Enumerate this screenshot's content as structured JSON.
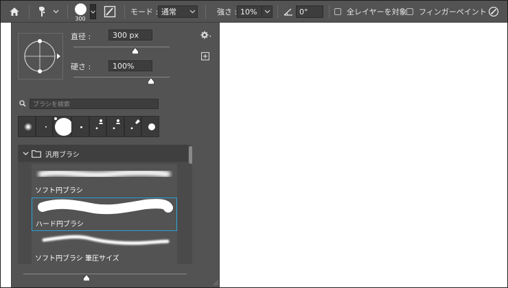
{
  "toolbar": {
    "brush_size": "300",
    "mode_label": "モード :",
    "mode_value": "通常",
    "strength_label": "強さ :",
    "strength_value": "10%",
    "angle_value": "0°",
    "sample_all_layers_label": "全レイヤーを対象",
    "finger_painting_label": "フィンガーペイント"
  },
  "brush_panel": {
    "size_label": "直径 :",
    "size_value": "300 px",
    "size_slider_value": 300,
    "hardness_label": "硬さ :",
    "hardness_value": "100%",
    "search_placeholder": "ブラシを検索",
    "group_name": "汎用ブラシ",
    "brushes": [
      {
        "name": "ソフト円ブラシ",
        "selected": false
      },
      {
        "name": "ハード円ブラシ",
        "selected": true
      },
      {
        "name": "ソフト円ブラシ 筆圧サイズ",
        "selected": false
      }
    ]
  },
  "colors": {
    "panel_bg": "#535353",
    "selection": "#2fa6db",
    "canvas": "#ffffff"
  }
}
